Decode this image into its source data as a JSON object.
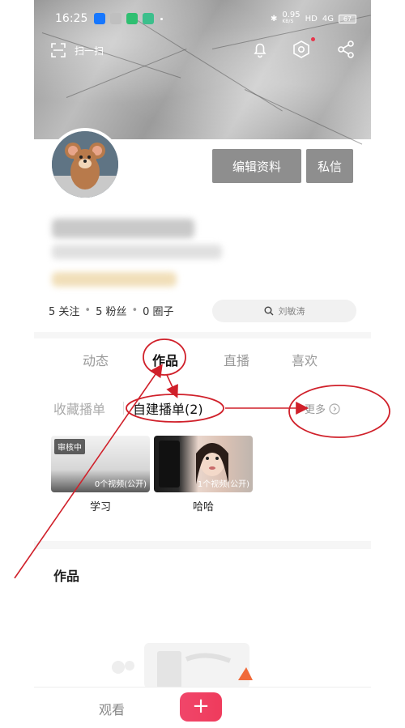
{
  "status_bar": {
    "time": "16:25",
    "network_speed": "0.95",
    "network_unit": "KB/S",
    "hd": "HD",
    "signal": "4G",
    "battery": "67"
  },
  "header": {
    "scan_label": "扫一扫"
  },
  "profile": {
    "edit_button": "编辑资料",
    "message_button": "私信",
    "stats": {
      "following": "5 关注",
      "followers": "5 粉丝",
      "circles": "0 圈子",
      "separator": "•"
    },
    "search_placeholder": "刘敏涛"
  },
  "tabs": [
    {
      "label": "动态"
    },
    {
      "label": "作品"
    },
    {
      "label": "直播"
    },
    {
      "label": "喜欢"
    }
  ],
  "playlists": {
    "favorites_tab": "收藏播单",
    "created_tab": "自建播单(2)",
    "more_label": "更多",
    "items": [
      {
        "badge": "审核中",
        "count": "0个视频(公开)",
        "title": "学习"
      },
      {
        "badge": "",
        "count": "1个视频(公开)",
        "title": "哈哈"
      }
    ]
  },
  "works_section": {
    "title": "作品"
  },
  "bottom_nav": {
    "watch_label": "观看",
    "plus_label": "+"
  },
  "colors": {
    "accent": "#ef3b5c",
    "annotation": "#d0202a",
    "button_grey": "#8e8e8e"
  }
}
